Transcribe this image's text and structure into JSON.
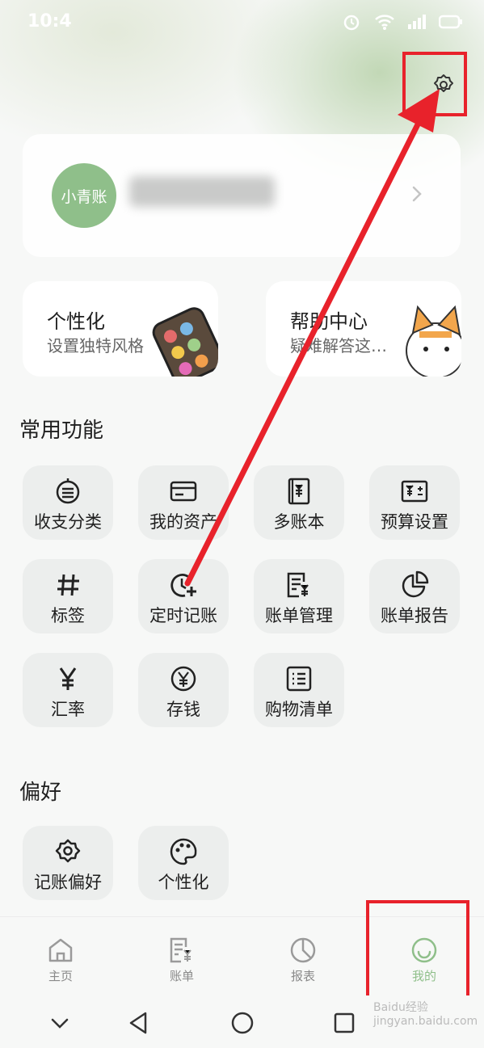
{
  "status_bar": {
    "time": "10:4"
  },
  "profile": {
    "avatar_text": "小青账"
  },
  "feature_cards": [
    {
      "title": "个性化",
      "subtitle": "设置独特风格"
    },
    {
      "title": "帮助中心",
      "subtitle": "疑难解答这…"
    }
  ],
  "sections": {
    "common": "常用功能",
    "preferences": "偏好"
  },
  "common_functions": [
    {
      "label": "收支分类",
      "icon": "category-icon"
    },
    {
      "label": "我的资产",
      "icon": "card-icon"
    },
    {
      "label": "多账本",
      "icon": "ledger-book-icon"
    },
    {
      "label": "预算设置",
      "icon": "budget-icon"
    },
    {
      "label": "标签",
      "icon": "hashtag-icon"
    },
    {
      "label": "定时记账",
      "icon": "scheduled-icon"
    },
    {
      "label": "账单管理",
      "icon": "bill-manage-icon"
    },
    {
      "label": "账单报告",
      "icon": "pie-chart-icon"
    },
    {
      "label": "汇率",
      "icon": "yen-icon"
    },
    {
      "label": "存钱",
      "icon": "yen-coin-icon"
    },
    {
      "label": "购物清单",
      "icon": "list-icon"
    }
  ],
  "preference_functions": [
    {
      "label": "记账偏好",
      "icon": "gear-icon"
    },
    {
      "label": "个性化",
      "icon": "palette-icon"
    }
  ],
  "tabs": [
    {
      "label": "主页",
      "icon": "home-icon"
    },
    {
      "label": "账单",
      "icon": "bill-icon"
    },
    {
      "label": "报表",
      "icon": "report-icon"
    },
    {
      "label": "我的",
      "icon": "smile-icon"
    }
  ],
  "colors": {
    "accent": "#8fbf8a",
    "highlight": "#e8222b",
    "active_tab": "#8fbf8a"
  },
  "watermark": "Baidu经验 jingyan.baidu.com"
}
